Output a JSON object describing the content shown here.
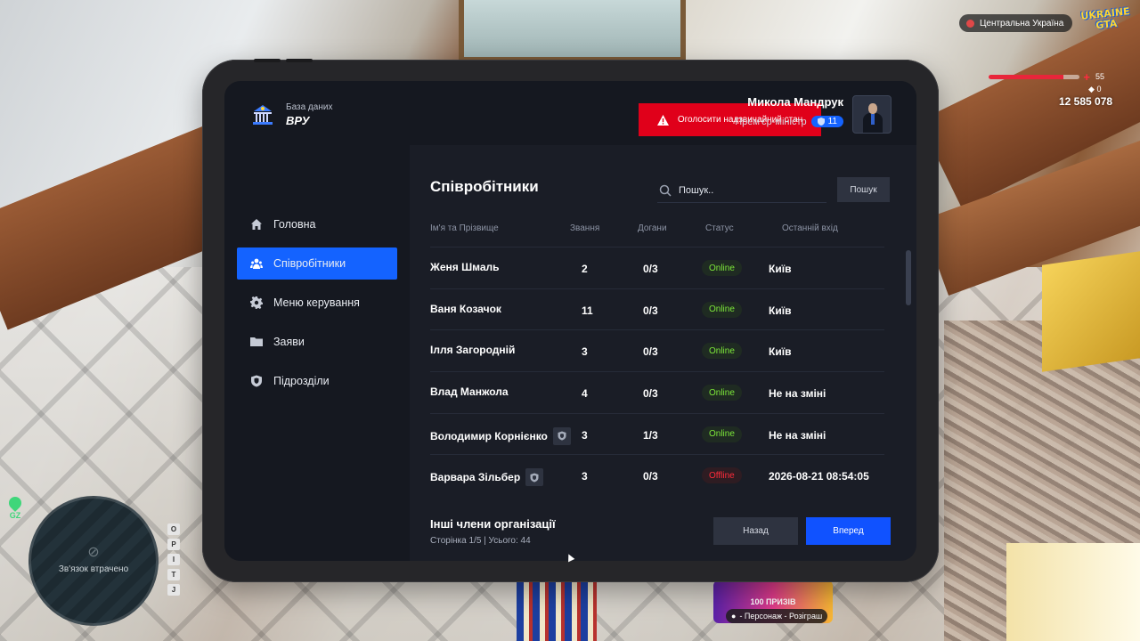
{
  "hud": {
    "region": "Центральна Україна",
    "logo_line1": "UKRAINE",
    "logo_line2": "GTA",
    "health_value": "55",
    "health_fraction": 0.82,
    "armor_value": "0",
    "money": "12 585 078",
    "minimap_status": "Зв'язок втрачено",
    "gps_label": "GZ",
    "hotkeys": [
      "O",
      "P",
      "I",
      "T",
      "J"
    ],
    "promo_text": "100 ПРИЗІВ",
    "promo_caption": "- Персонаж - Розіграш"
  },
  "app": {
    "brand_subtitle": "База даних",
    "brand_title": "ВРУ",
    "alert_button": "Оголосити надзвичайний стан",
    "user_name": "Микола Мандрук",
    "user_role": "Прем'єр-міністр",
    "user_rank": "11",
    "accent_color": "#1463ff",
    "alert_color": "#e0001a"
  },
  "nav": [
    {
      "label": "Головна",
      "icon": "home-icon",
      "active": false
    },
    {
      "label": "Співробітники",
      "icon": "users-icon",
      "active": true
    },
    {
      "label": "Меню керування",
      "icon": "gear-icon",
      "active": false
    },
    {
      "label": "Заяви",
      "icon": "folder-icon",
      "active": false
    },
    {
      "label": "Підрозділи",
      "icon": "shield-icon",
      "active": false
    }
  ],
  "main": {
    "title": "Співробітники",
    "search_placeholder": "Пошук..",
    "search_button": "Пошук",
    "columns": [
      "Ім'я та Прізвище",
      "Звання",
      "Догани",
      "Статус",
      "Останній вхід"
    ],
    "rows": [
      {
        "name": "Женя Шмаль",
        "rank": "2",
        "warnings": "0/3",
        "status": "Online",
        "last": "Київ",
        "badge": false
      },
      {
        "name": "Ваня Козачок",
        "rank": "11",
        "warnings": "0/3",
        "status": "Online",
        "last": "Київ",
        "badge": false
      },
      {
        "name": "Ілля Загородній",
        "rank": "3",
        "warnings": "0/3",
        "status": "Online",
        "last": "Київ",
        "badge": false
      },
      {
        "name": "Влад Манжола",
        "rank": "4",
        "warnings": "0/3",
        "status": "Online",
        "last": "Не на зміні",
        "badge": false
      },
      {
        "name": "Володимир Корнієнко",
        "rank": "3",
        "warnings": "1/3",
        "status": "Online",
        "last": "Не на зміні",
        "badge": true
      },
      {
        "name": "Варвара Зільбер",
        "rank": "3",
        "warnings": "0/3",
        "status": "Offline",
        "last": "2026-08-21 08:54:05",
        "badge": true
      }
    ],
    "footer_title": "Інші члени організації",
    "footer_sub": "Сторінка 1/5 | Усього: 44",
    "back_button": "Назад",
    "next_button": "Вперед"
  }
}
